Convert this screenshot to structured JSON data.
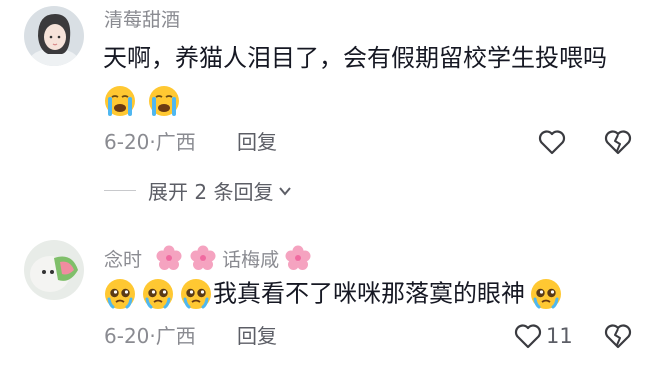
{
  "comments": [
    {
      "username": "清莓甜酒",
      "text": "天啊，养猫人泪目了，会有假期留校学生投喂吗",
      "emojis": [
        "crying-face",
        "crying-face"
      ],
      "date": "6-20",
      "location": "广西",
      "separator": "·",
      "reply_label": "回复",
      "replies_expand": "展开 2 条回复"
    },
    {
      "username_parts": [
        "念时",
        "话梅咸"
      ],
      "text": "我真看不了咪咪那落寞的眼神",
      "leading_emojis": [
        "pleading-face",
        "pleading-face",
        "pleading-face"
      ],
      "trailing_emojis": [
        "pleading-face"
      ],
      "date": "6-20",
      "location": "广西",
      "separator": "·",
      "reply_label": "回复",
      "like_count": "11"
    }
  ],
  "colors": {
    "meta": "#8a8b91",
    "text": "#161823",
    "flower": "#f06aa0",
    "emoji": "#ffc832"
  }
}
